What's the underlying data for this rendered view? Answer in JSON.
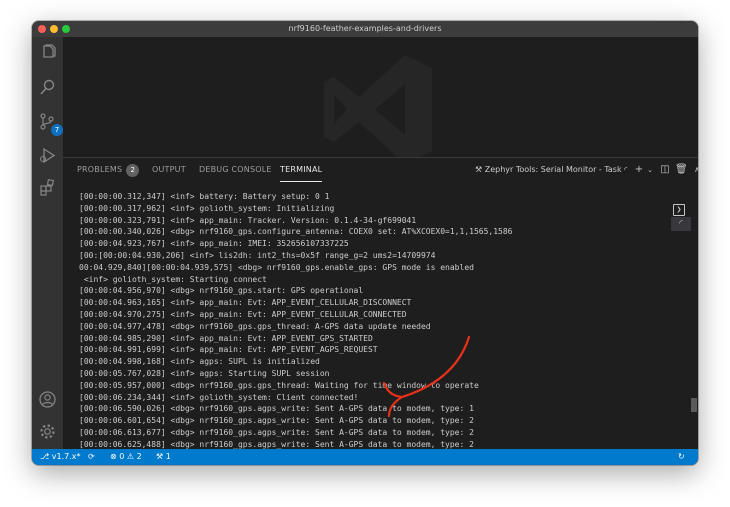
{
  "window": {
    "title": "nrf9160-feather-examples-and-drivers"
  },
  "activity_bar": {
    "source_control_badge": "7"
  },
  "panel": {
    "tabs": [
      {
        "label": "PROBLEMS",
        "count": "2"
      },
      {
        "label": "OUTPUT"
      },
      {
        "label": "DEBUG CONSOLE"
      },
      {
        "label": "TERMINAL"
      }
    ],
    "task_label": "Zephyr Tools: Serial Monitor - Task"
  },
  "terminal": {
    "lines": [
      "[00:00:00.312,347] <inf> battery: Battery setup: 0 1",
      "[00:00:00.317,962] <inf> golioth_system: Initializing",
      "[00:00:00.323,791] <inf> app_main: Tracker. Version: 0.1.4-34-gf699041",
      "[00:00:00.340,026] <dbg> nrf9160_gps.configure_antenna: COEX0 set: AT%XCOEX0=1,1,1565,1586",
      "[00:00:04.923,767] <inf> app_main: IMEI: 352656107337225",
      "[00:[00:00:04.930,206] <inf> lis2dh: int2_ths=0x5f range_g=2 ums2=14709974",
      "00:04.929,840][00:00:04.939,575] <dbg> nrf9160_gps.enable_gps: GPS mode is enabled",
      " <inf> golioth_system: Starting connect",
      "[00:00:04.956,970] <dbg> nrf9160_gps.start: GPS operational",
      "[00:00:04.963,165] <inf> app_main: Evt: APP_EVENT_CELLULAR_DISCONNECT",
      "[00:00:04.970,275] <inf> app_main: Evt: APP_EVENT_CELLULAR_CONNECTED",
      "[00:00:04.977,478] <dbg> nrf9160_gps.gps_thread: A-GPS data update needed",
      "[00:00:04.985,290] <inf> app_main: Evt: APP_EVENT_GPS_STARTED",
      "[00:00:04.991,699] <inf> app_main: Evt: APP_EVENT_AGPS_REQUEST",
      "[00:00:04.998,168] <inf> agps: SUPL is initialized",
      "[00:00:05.767,028] <inf> agps: Starting SUPL session",
      "[00:00:05.957,000] <dbg> nrf9160_gps.gps_thread: Waiting for time window to operate",
      "[00:00:06.234,344] <inf> golioth_system: Client connected!",
      "[00:00:06.590,026] <dbg> nrf9160_gps.agps_write: Sent A-GPS data to modem, type: 1",
      "[00:00:06.601,654] <dbg> nrf9160_gps.agps_write: Sent A-GPS data to modem, type: 2",
      "[00:00:06.613,677] <dbg> nrf9160_gps.agps_write: Sent A-GPS data to modem, type: 2",
      "[00:00:06.625,488] <dbg> nrf9160_gps.agps_write: Sent A-GPS data to modem, type: 2"
    ]
  },
  "status_bar": {
    "branch": "v1.7.x*",
    "errors": "0",
    "warnings": "2",
    "tools_count": "1"
  },
  "colors": {
    "status_bar": "#007acc",
    "annotation_arrow": "#e8311a"
  }
}
